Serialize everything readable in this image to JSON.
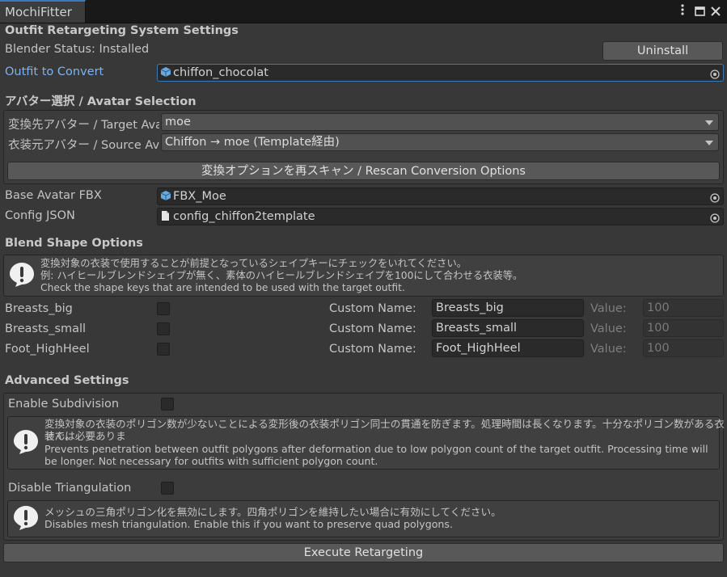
{
  "window": {
    "tab_title": "MochiFitter",
    "menu_icon": "kebab-menu-icon",
    "maximize_icon": "maximize-icon",
    "close_icon": "close-icon"
  },
  "header": {
    "title": "Outfit Retargeting System Settings",
    "blender_status": "Blender Status: Installed",
    "uninstall_label": "Uninstall",
    "outfit_label": "Outfit to Convert",
    "outfit_value": "chiffon_chocolat"
  },
  "avatar_selection": {
    "title": "アバター選択 / Avatar Selection",
    "target_label": "変換先アバター / Target Avatar",
    "target_value": "moe",
    "source_label": "衣装元アバター / Source Avatar",
    "source_value": "Chiffon → moe (Template経由)",
    "rescan_label": "変換オプションを再スキャン / Rescan Conversion Options",
    "base_fbx_label": "Base Avatar FBX",
    "base_fbx_value": "FBX_Moe",
    "config_label": "Config JSON",
    "config_value": "config_chiffon2template"
  },
  "blend_shape": {
    "title": "Blend Shape Options",
    "help_lines": [
      "変換対象の衣装で使用することが前提となっているシェイプキーにチェックをいれてください。",
      "例: ハイヒールブレンドシェイプが無く、素体のハイヒールブレンドシェイプを100にして合わせる衣装等。",
      "Check the shape keys that are intended to be used with the target outfit."
    ],
    "custom_name_label": "Custom Name:",
    "value_label": "Value:",
    "rows": [
      {
        "name": "Breasts_big",
        "custom": "Breasts_big",
        "value": "100",
        "checked": false
      },
      {
        "name": "Breasts_small",
        "custom": "Breasts_small",
        "value": "100",
        "checked": false
      },
      {
        "name": "Foot_HighHeel",
        "custom": "Foot_HighHeel",
        "value": "100",
        "checked": false
      }
    ]
  },
  "advanced": {
    "title": "Advanced Settings",
    "subdivision_label": "Enable Subdivision",
    "subdivision_checked": false,
    "subdivision_help": [
      "変換対象の衣装のポリゴン数が少ないことによる変形後の衣装ポリゴン同士の貫通を防ぎます。処理時間は長くなります。十分なポリゴン数がある衣装では必要ありま",
      "せん。",
      "Prevents penetration between outfit polygons after deformation due to low polygon count of the target outfit. Processing time will",
      "be longer. Not necessary for outfits with sufficient polygon count."
    ],
    "triangulation_label": "Disable Triangulation",
    "triangulation_checked": false,
    "triangulation_help": [
      "メッシュの三角ポリゴン化を無効にします。四角ポリゴンを維持したい場合に有効にしてください。",
      "Disables mesh triangulation. Enable this if you want to preserve quad polygons."
    ]
  },
  "execute_label": "Execute Retargeting",
  "colors": {
    "background": "#383838",
    "accent": "#3a79bb",
    "link_label": "#7cb3f0"
  }
}
